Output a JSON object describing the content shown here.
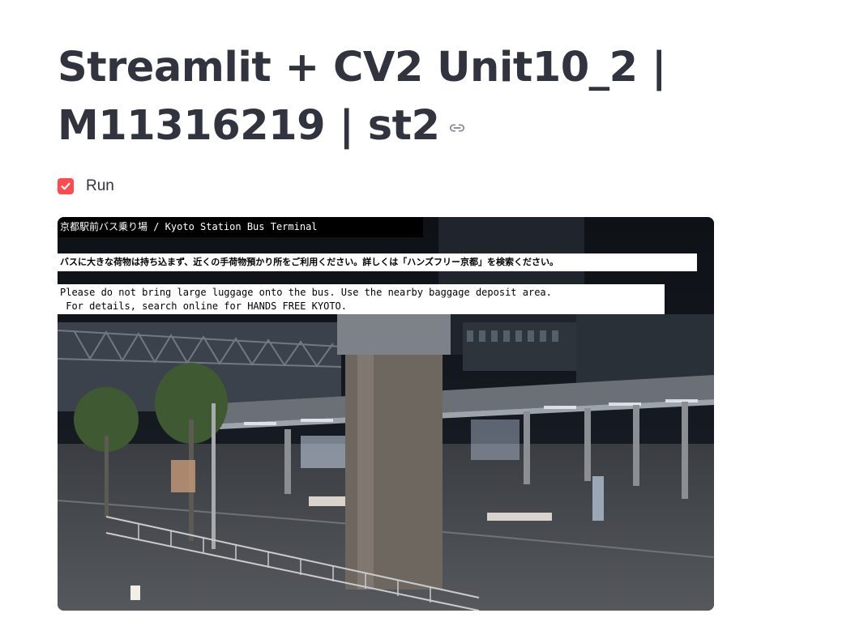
{
  "page": {
    "title_line1": "Streamlit + CV2 Unit10_2 |",
    "title_line2": "M11316219 | st2"
  },
  "run_checkbox": {
    "label": "Run",
    "checked": true,
    "accent_color": "#ff4b4b"
  },
  "camera_frame": {
    "caption_top": "京都駅前バス乗り場 / Kyoto Station Bus Terminal",
    "notice_japanese": "バスに大きな荷物は持ち込まず、近くの手荷物預かり所をご利用ください。詳しくは「ハンズフリー京都」を検索ください。",
    "notice_english_line1": "Please do not bring large luggage onto the bus. Use the nearby baggage deposit area.",
    "notice_english_line2": " For details, search online for HANDS FREE KYOTO."
  }
}
